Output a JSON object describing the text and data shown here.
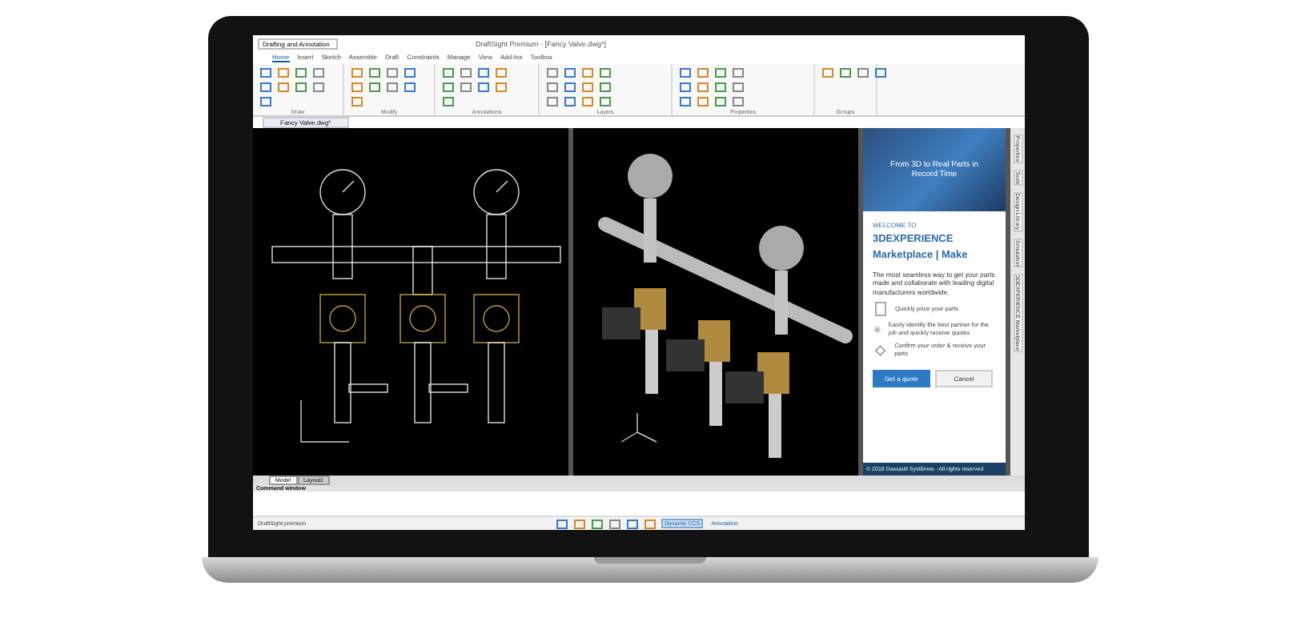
{
  "window": {
    "title": "DraftSight Premium - [Fancy Valve.dwg*]",
    "workspace": "Drafting and Annotation"
  },
  "ribbon": {
    "tabs": [
      {
        "label": "Home",
        "selected": true
      },
      {
        "label": "Insert",
        "selected": false
      },
      {
        "label": "Sketch",
        "selected": false
      },
      {
        "label": "Assemble",
        "selected": false
      },
      {
        "label": "Draft",
        "selected": false
      },
      {
        "label": "Constraints",
        "selected": false
      },
      {
        "label": "Manage",
        "selected": false
      },
      {
        "label": "View",
        "selected": false
      },
      {
        "label": "Add-Ins",
        "selected": false
      },
      {
        "label": "Toolbox",
        "selected": false
      }
    ],
    "groups": [
      {
        "label": "Draw"
      },
      {
        "label": "Modify"
      },
      {
        "label": "Annotations"
      },
      {
        "label": "Layers"
      },
      {
        "label": "Properties"
      },
      {
        "label": "Groups"
      }
    ]
  },
  "document_tabs": [
    {
      "label": "Fancy Valve.dwg*",
      "selected": true
    }
  ],
  "viewports": [
    {
      "kind": "wireframe"
    },
    {
      "kind": "shaded"
    }
  ],
  "side_panel": {
    "banner": "From 3D to Real Parts in Record Time",
    "kicker": "WELCOME TO",
    "title": "3DEXPERIENCE",
    "subtitle": "Marketplace | Make",
    "intro": "The most seamless way to get your parts made and collaborate with leading digital manufacturers worldwide.",
    "features": [
      {
        "text": "Quickly price your parts",
        "kind": "price"
      },
      {
        "text": "Easily identify the best partner for the job and quickly receive quotes",
        "kind": "partner"
      },
      {
        "text": "Confirm your order & receive your parts",
        "kind": "order"
      }
    ],
    "buttons": [
      {
        "label": "Get a quote",
        "kind": "primary"
      },
      {
        "label": "Cancel",
        "kind": "secondary"
      }
    ],
    "footer": "© 2018 Dassault Systèmes - All rights reserved"
  },
  "side_tabs": [
    "Properties",
    "Tools",
    "Design Library",
    "Simulation",
    "3DEXPERIENCE Marketplace"
  ],
  "layout_tabs": [
    {
      "label": "Model",
      "selected": true
    },
    {
      "label": "Layout1",
      "selected": false
    }
  ],
  "command_window": {
    "title": "Command window"
  },
  "status_bar": {
    "left": "DraftSight premium",
    "dynamic": "Dynamic CCS",
    "annotation": "Annotation"
  }
}
